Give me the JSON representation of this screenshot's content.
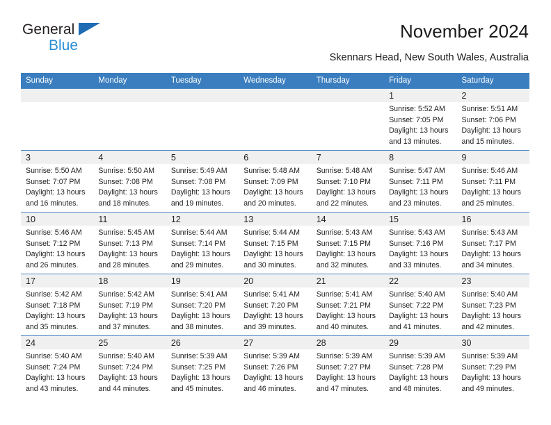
{
  "brand": {
    "line1": "General",
    "line2": "Blue",
    "triangle_color": "#1f6cb4",
    "line2_color": "#2a8fd4"
  },
  "header": {
    "title": "November 2024",
    "subtitle": "Skennars Head, New South Wales, Australia"
  },
  "theme": {
    "header_row_bg": "#3a7ebf",
    "header_row_text": "#ffffff",
    "daynum_bg": "#f0f0f0",
    "cell_bg": "#ffffff",
    "grid_line": "#4a86c0"
  },
  "calendar": {
    "weekday_headers": [
      "Sunday",
      "Monday",
      "Tuesday",
      "Wednesday",
      "Thursday",
      "Friday",
      "Saturday"
    ],
    "labels": {
      "sunrise": "Sunrise:",
      "sunset": "Sunset:",
      "daylight": "Daylight:"
    },
    "weeks": [
      [
        {
          "day": "",
          "empty": true
        },
        {
          "day": "",
          "empty": true
        },
        {
          "day": "",
          "empty": true
        },
        {
          "day": "",
          "empty": true
        },
        {
          "day": "",
          "empty": true
        },
        {
          "day": "1",
          "empty": false,
          "sunrise": "Sunrise: 5:52 AM",
          "sunset": "Sunset: 7:05 PM",
          "daylight_1": "Daylight: 13 hours",
          "daylight_2": "and 13 minutes."
        },
        {
          "day": "2",
          "empty": false,
          "sunrise": "Sunrise: 5:51 AM",
          "sunset": "Sunset: 7:06 PM",
          "daylight_1": "Daylight: 13 hours",
          "daylight_2": "and 15 minutes."
        }
      ],
      [
        {
          "day": "3",
          "empty": false,
          "sunrise": "Sunrise: 5:50 AM",
          "sunset": "Sunset: 7:07 PM",
          "daylight_1": "Daylight: 13 hours",
          "daylight_2": "and 16 minutes."
        },
        {
          "day": "4",
          "empty": false,
          "sunrise": "Sunrise: 5:50 AM",
          "sunset": "Sunset: 7:08 PM",
          "daylight_1": "Daylight: 13 hours",
          "daylight_2": "and 18 minutes."
        },
        {
          "day": "5",
          "empty": false,
          "sunrise": "Sunrise: 5:49 AM",
          "sunset": "Sunset: 7:08 PM",
          "daylight_1": "Daylight: 13 hours",
          "daylight_2": "and 19 minutes."
        },
        {
          "day": "6",
          "empty": false,
          "sunrise": "Sunrise: 5:48 AM",
          "sunset": "Sunset: 7:09 PM",
          "daylight_1": "Daylight: 13 hours",
          "daylight_2": "and 20 minutes."
        },
        {
          "day": "7",
          "empty": false,
          "sunrise": "Sunrise: 5:48 AM",
          "sunset": "Sunset: 7:10 PM",
          "daylight_1": "Daylight: 13 hours",
          "daylight_2": "and 22 minutes."
        },
        {
          "day": "8",
          "empty": false,
          "sunrise": "Sunrise: 5:47 AM",
          "sunset": "Sunset: 7:11 PM",
          "daylight_1": "Daylight: 13 hours",
          "daylight_2": "and 23 minutes."
        },
        {
          "day": "9",
          "empty": false,
          "sunrise": "Sunrise: 5:46 AM",
          "sunset": "Sunset: 7:11 PM",
          "daylight_1": "Daylight: 13 hours",
          "daylight_2": "and 25 minutes."
        }
      ],
      [
        {
          "day": "10",
          "empty": false,
          "sunrise": "Sunrise: 5:46 AM",
          "sunset": "Sunset: 7:12 PM",
          "daylight_1": "Daylight: 13 hours",
          "daylight_2": "and 26 minutes."
        },
        {
          "day": "11",
          "empty": false,
          "sunrise": "Sunrise: 5:45 AM",
          "sunset": "Sunset: 7:13 PM",
          "daylight_1": "Daylight: 13 hours",
          "daylight_2": "and 28 minutes."
        },
        {
          "day": "12",
          "empty": false,
          "sunrise": "Sunrise: 5:44 AM",
          "sunset": "Sunset: 7:14 PM",
          "daylight_1": "Daylight: 13 hours",
          "daylight_2": "and 29 minutes."
        },
        {
          "day": "13",
          "empty": false,
          "sunrise": "Sunrise: 5:44 AM",
          "sunset": "Sunset: 7:15 PM",
          "daylight_1": "Daylight: 13 hours",
          "daylight_2": "and 30 minutes."
        },
        {
          "day": "14",
          "empty": false,
          "sunrise": "Sunrise: 5:43 AM",
          "sunset": "Sunset: 7:15 PM",
          "daylight_1": "Daylight: 13 hours",
          "daylight_2": "and 32 minutes."
        },
        {
          "day": "15",
          "empty": false,
          "sunrise": "Sunrise: 5:43 AM",
          "sunset": "Sunset: 7:16 PM",
          "daylight_1": "Daylight: 13 hours",
          "daylight_2": "and 33 minutes."
        },
        {
          "day": "16",
          "empty": false,
          "sunrise": "Sunrise: 5:43 AM",
          "sunset": "Sunset: 7:17 PM",
          "daylight_1": "Daylight: 13 hours",
          "daylight_2": "and 34 minutes."
        }
      ],
      [
        {
          "day": "17",
          "empty": false,
          "sunrise": "Sunrise: 5:42 AM",
          "sunset": "Sunset: 7:18 PM",
          "daylight_1": "Daylight: 13 hours",
          "daylight_2": "and 35 minutes."
        },
        {
          "day": "18",
          "empty": false,
          "sunrise": "Sunrise: 5:42 AM",
          "sunset": "Sunset: 7:19 PM",
          "daylight_1": "Daylight: 13 hours",
          "daylight_2": "and 37 minutes."
        },
        {
          "day": "19",
          "empty": false,
          "sunrise": "Sunrise: 5:41 AM",
          "sunset": "Sunset: 7:20 PM",
          "daylight_1": "Daylight: 13 hours",
          "daylight_2": "and 38 minutes."
        },
        {
          "day": "20",
          "empty": false,
          "sunrise": "Sunrise: 5:41 AM",
          "sunset": "Sunset: 7:20 PM",
          "daylight_1": "Daylight: 13 hours",
          "daylight_2": "and 39 minutes."
        },
        {
          "day": "21",
          "empty": false,
          "sunrise": "Sunrise: 5:41 AM",
          "sunset": "Sunset: 7:21 PM",
          "daylight_1": "Daylight: 13 hours",
          "daylight_2": "and 40 minutes."
        },
        {
          "day": "22",
          "empty": false,
          "sunrise": "Sunrise: 5:40 AM",
          "sunset": "Sunset: 7:22 PM",
          "daylight_1": "Daylight: 13 hours",
          "daylight_2": "and 41 minutes."
        },
        {
          "day": "23",
          "empty": false,
          "sunrise": "Sunrise: 5:40 AM",
          "sunset": "Sunset: 7:23 PM",
          "daylight_1": "Daylight: 13 hours",
          "daylight_2": "and 42 minutes."
        }
      ],
      [
        {
          "day": "24",
          "empty": false,
          "sunrise": "Sunrise: 5:40 AM",
          "sunset": "Sunset: 7:24 PM",
          "daylight_1": "Daylight: 13 hours",
          "daylight_2": "and 43 minutes."
        },
        {
          "day": "25",
          "empty": false,
          "sunrise": "Sunrise: 5:40 AM",
          "sunset": "Sunset: 7:24 PM",
          "daylight_1": "Daylight: 13 hours",
          "daylight_2": "and 44 minutes."
        },
        {
          "day": "26",
          "empty": false,
          "sunrise": "Sunrise: 5:39 AM",
          "sunset": "Sunset: 7:25 PM",
          "daylight_1": "Daylight: 13 hours",
          "daylight_2": "and 45 minutes."
        },
        {
          "day": "27",
          "empty": false,
          "sunrise": "Sunrise: 5:39 AM",
          "sunset": "Sunset: 7:26 PM",
          "daylight_1": "Daylight: 13 hours",
          "daylight_2": "and 46 minutes."
        },
        {
          "day": "28",
          "empty": false,
          "sunrise": "Sunrise: 5:39 AM",
          "sunset": "Sunset: 7:27 PM",
          "daylight_1": "Daylight: 13 hours",
          "daylight_2": "and 47 minutes."
        },
        {
          "day": "29",
          "empty": false,
          "sunrise": "Sunrise: 5:39 AM",
          "sunset": "Sunset: 7:28 PM",
          "daylight_1": "Daylight: 13 hours",
          "daylight_2": "and 48 minutes."
        },
        {
          "day": "30",
          "empty": false,
          "sunrise": "Sunrise: 5:39 AM",
          "sunset": "Sunset: 7:29 PM",
          "daylight_1": "Daylight: 13 hours",
          "daylight_2": "and 49 minutes."
        }
      ]
    ]
  }
}
